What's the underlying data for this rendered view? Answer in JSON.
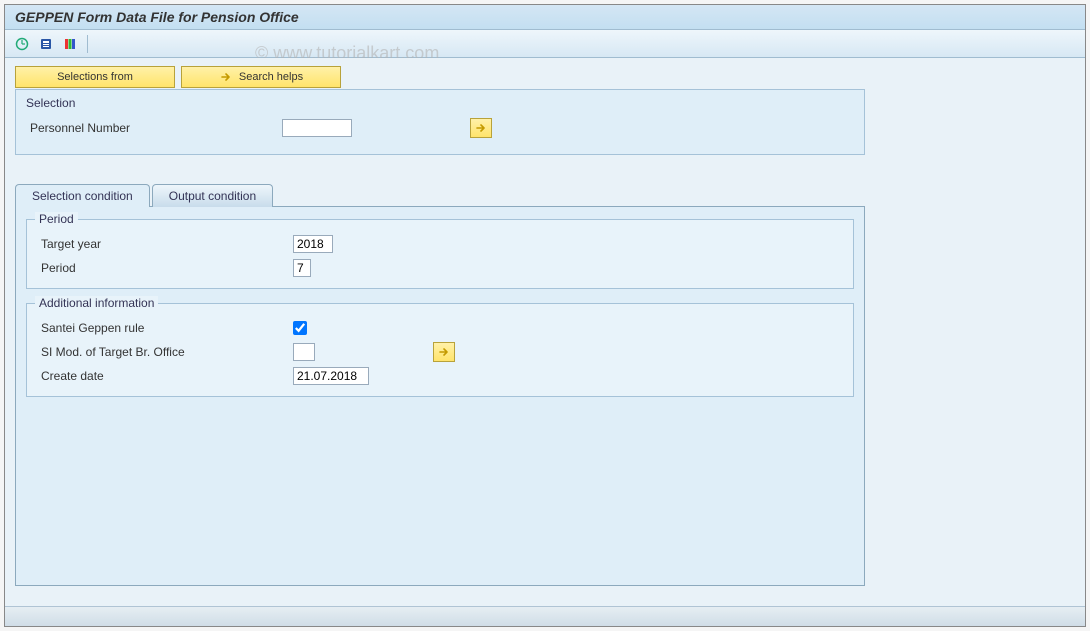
{
  "title": "GEPPEN Form Data File for Pension Office",
  "watermark": "© www.tutorialkart.com",
  "toolbar_buttons": {
    "selections_from": "Selections from",
    "search_helps": "Search helps"
  },
  "selection_group": {
    "legend": "Selection",
    "fields": {
      "personnel_number": {
        "label": "Personnel Number",
        "value": ""
      }
    }
  },
  "tabs": {
    "selection_condition": "Selection condition",
    "output_condition": "Output condition",
    "active": "selection_condition"
  },
  "period_group": {
    "legend": "Period",
    "target_year": {
      "label": "Target year",
      "value": "2018"
    },
    "period": {
      "label": "Period",
      "value": "7"
    }
  },
  "additional_info_group": {
    "legend": "Additional information",
    "santei_geppen_rule": {
      "label": "Santei Geppen rule",
      "checked": true
    },
    "si_mod": {
      "label": "SI Mod. of Target Br. Office",
      "value": ""
    },
    "create_date": {
      "label": "Create date",
      "value": "21.07.2018"
    }
  }
}
